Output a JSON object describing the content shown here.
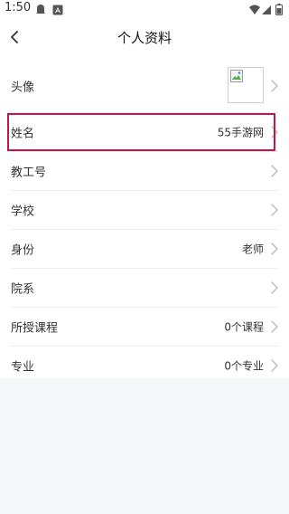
{
  "status_bar": {
    "time": "1:50",
    "icons": [
      "ghost-icon",
      "a-icon",
      "wifi-icon",
      "signal-icon",
      "battery-icon"
    ]
  },
  "header": {
    "title": "个人资料",
    "back_icon": "chevron-left-icon"
  },
  "rows": {
    "avatar": {
      "label": "头像"
    },
    "name": {
      "label": "姓名",
      "value": "55手游网"
    },
    "staff_id": {
      "label": "教工号",
      "value": ""
    },
    "school": {
      "label": "学校",
      "value": ""
    },
    "identity": {
      "label": "身份",
      "value": "老师"
    },
    "department": {
      "label": "院系",
      "value": ""
    },
    "courses": {
      "label": "所授课程",
      "value": "0个课程"
    },
    "major": {
      "label": "专业",
      "value": "0个专业"
    }
  },
  "colors": {
    "highlight": "#c0164d",
    "divider": "#ececec",
    "bottom_background": "#f6f7f9"
  }
}
